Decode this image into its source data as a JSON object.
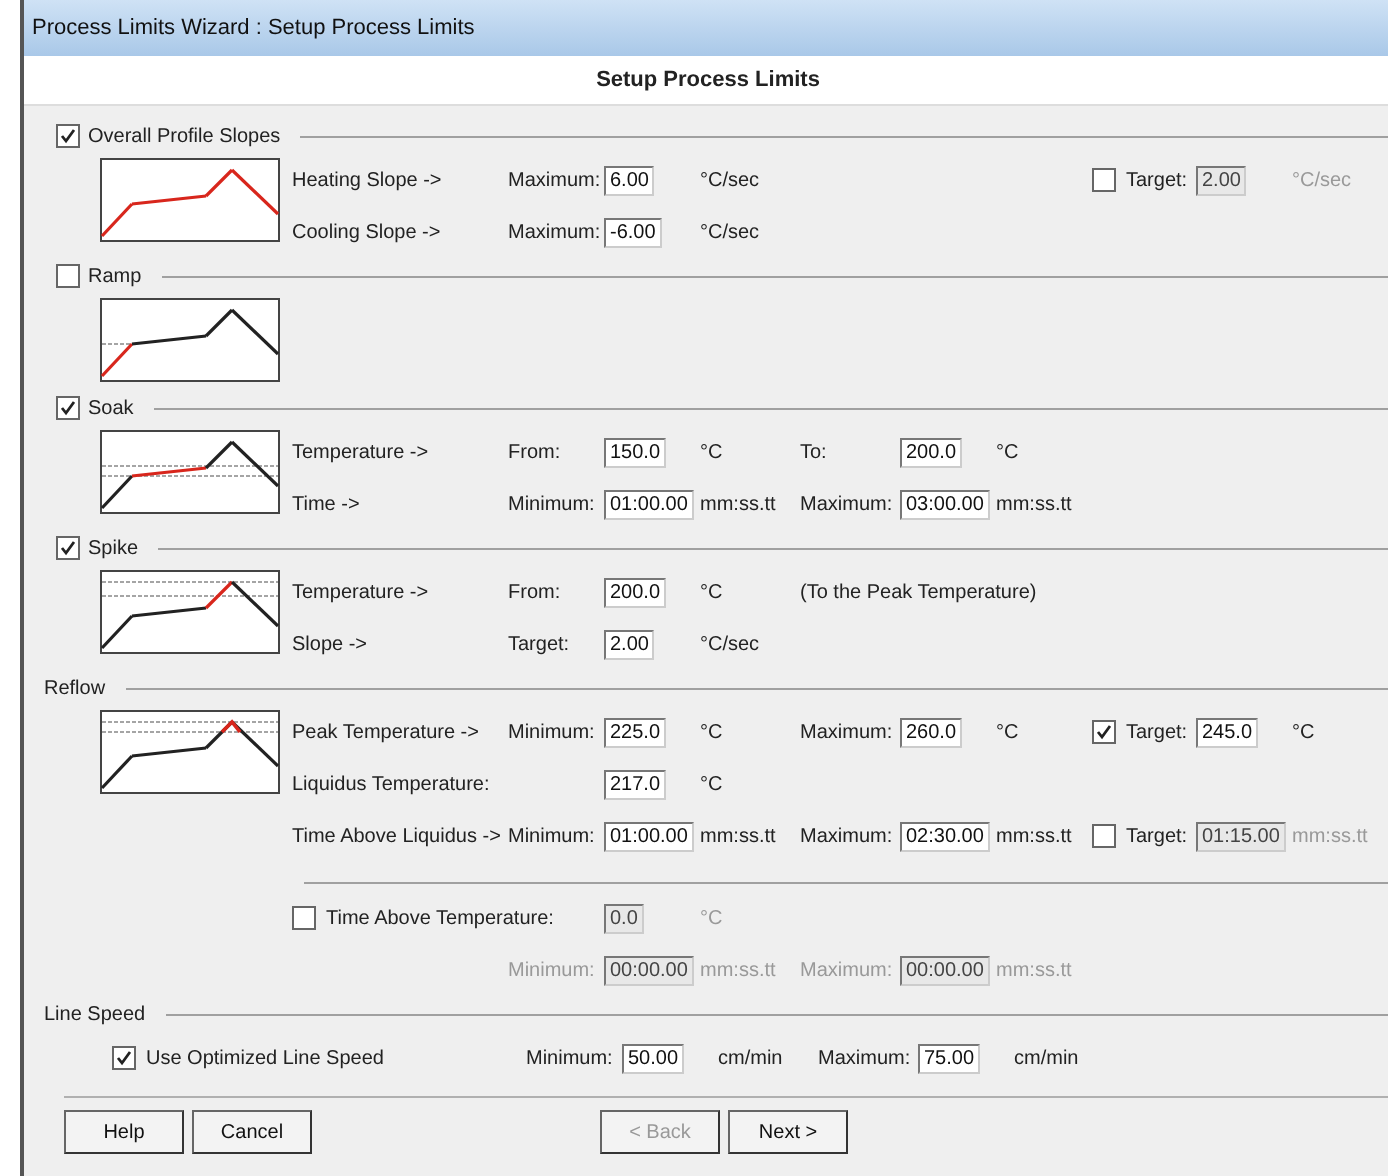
{
  "window": {
    "title": "Process Limits Wizard : Setup Process Limits"
  },
  "heading": "Setup Process Limits",
  "sections": [
    {
      "label": "Overall Profile Slopes",
      "kind": "check",
      "checked": true,
      "graph": {
        "kind": "all"
      },
      "rows": [
        {
          "label": "Heating Slope ->",
          "groups": [
            {
              "kind": "field",
              "prefix": "Maximum:",
              "value": "6.00",
              "unit": "°C/sec",
              "disabled": false
            },
            {
              "kind": "empty"
            },
            {
              "kind": "check-field",
              "label": "Target:",
              "checked": false,
              "value": "2.00",
              "unit": "°C/sec",
              "disabled": true
            }
          ]
        },
        {
          "label": "Cooling Slope ->",
          "groups": [
            {
              "kind": "field",
              "prefix": "Maximum:",
              "value": "-6.00",
              "unit": "°C/sec",
              "disabled": false
            }
          ]
        }
      ]
    },
    {
      "label": "Ramp",
      "kind": "check",
      "checked": false,
      "graph": {
        "kind": "ramp"
      }
    },
    {
      "label": "Soak",
      "kind": "check",
      "checked": true,
      "graph": {
        "kind": "soak"
      },
      "rows": [
        {
          "label": "Temperature ->",
          "groups": [
            {
              "kind": "field",
              "prefix": "From:",
              "value": "150.0",
              "unit": "°C",
              "disabled": false
            },
            {
              "kind": "field",
              "prefix": "To:",
              "value": "200.0",
              "unit": "°C",
              "disabled": false
            }
          ]
        },
        {
          "label": "Time ->",
          "groups": [
            {
              "kind": "field",
              "prefix": "Minimum:",
              "value": "01:00.00",
              "unit": "mm:ss.tt",
              "disabled": false
            },
            {
              "kind": "field",
              "prefix": "Maximum:",
              "value": "03:00.00",
              "unit": "mm:ss.tt",
              "disabled": false
            }
          ]
        }
      ]
    },
    {
      "label": "Spike",
      "kind": "check",
      "checked": true,
      "graph": {
        "kind": "spike"
      },
      "rows": [
        {
          "label": "Temperature ->",
          "groups": [
            {
              "kind": "field",
              "prefix": "From:",
              "value": "200.0",
              "unit": "°C",
              "disabled": false
            },
            {
              "kind": "note",
              "text": "(To the Peak Temperature)"
            }
          ]
        },
        {
          "label": "Slope ->",
          "groups": [
            {
              "kind": "field",
              "prefix": "Target:",
              "value": "2.00",
              "unit": "°C/sec",
              "disabled": false
            }
          ]
        }
      ]
    },
    {
      "label": "Reflow",
      "kind": "plain",
      "graph": {
        "kind": "peak"
      },
      "rows": [
        {
          "label": "Peak Temperature ->",
          "groups": [
            {
              "kind": "field",
              "prefix": "Minimum:",
              "value": "225.0",
              "unit": "°C",
              "disabled": false
            },
            {
              "kind": "field",
              "prefix": "Maximum:",
              "value": "260.0",
              "unit": "°C",
              "disabled": false
            },
            {
              "kind": "check-field",
              "label": "Target:",
              "checked": true,
              "value": "245.0",
              "unit": "°C",
              "disabled": false
            }
          ]
        },
        {
          "label": "Liquidus Temperature:",
          "groups": [
            {
              "kind": "field",
              "value": "217.0",
              "unit": "°C",
              "disabled": false
            }
          ]
        },
        {
          "label": "Time Above Liquidus ->",
          "groups": [
            {
              "kind": "field",
              "prefix": "Minimum:",
              "value": "01:00.00",
              "unit": "mm:ss.tt",
              "disabled": false
            },
            {
              "kind": "field",
              "prefix": "Maximum:",
              "value": "02:30.00",
              "unit": "mm:ss.tt",
              "disabled": false
            },
            {
              "kind": "check-field",
              "label": "Target:",
              "checked": false,
              "value": "01:15.00",
              "unit": "mm:ss.tt",
              "disabled": true
            }
          ]
        }
      ],
      "extra": [
        {
          "label": "Time Above Temperature:",
          "checked": false,
          "groups": [
            {
              "kind": "field",
              "value": "0.0",
              "unit": "°C",
              "disabled": true
            }
          ]
        },
        {
          "groups": [
            {
              "kind": "field",
              "prefix": "Minimum:",
              "value": "00:00.00",
              "unit": "mm:ss.tt",
              "disabled": true
            },
            {
              "kind": "field",
              "prefix": "Maximum:",
              "value": "00:00.00",
              "unit": "mm:ss.tt",
              "disabled": true
            }
          ]
        }
      ]
    },
    {
      "label": "Line Speed",
      "kind": "plain",
      "rows": [
        {
          "label": "Use Optimized Line Speed",
          "checked": true,
          "groups": [
            {
              "kind": "field",
              "prefix": "Minimum:",
              "value": "50.00",
              "unit": "cm/min",
              "disabled": false
            },
            {
              "kind": "field",
              "prefix": "Maximum:",
              "value": "75.00",
              "unit": "cm/min",
              "disabled": false
            }
          ]
        }
      ]
    }
  ],
  "buttons": [
    {
      "label": "Help",
      "disabled": false
    },
    {
      "label": "Cancel",
      "disabled": false
    },
    {
      "label": "< Back",
      "disabled": true
    },
    {
      "label": "Next >",
      "disabled": false
    }
  ]
}
